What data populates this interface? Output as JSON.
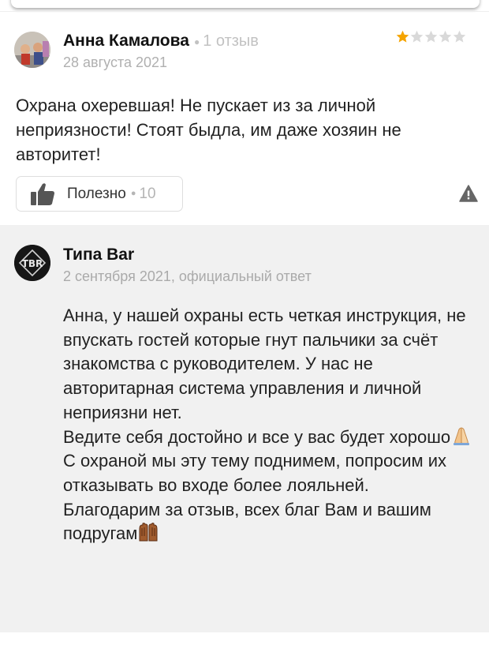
{
  "review": {
    "author_name": "Анна Камалова",
    "author_reviews": "1 отзыв",
    "date": "28 августа 2021",
    "rating": 1,
    "rating_max": 5,
    "colors": {
      "star_filled": "#f5a400",
      "star_empty": "#d9d9d9"
    },
    "text": "Охрана охеревшая! Не пускает из за личной неприязности! Стоят быдла, им даже хозяин не авторитет!",
    "useful_label": "Полезно",
    "useful_count": "10",
    "icons": {
      "like": "thumbs-up-icon",
      "report": "warning-icon"
    }
  },
  "answer": {
    "org_name": "Типа Bar",
    "date_line": "2 сентября 2021, официальный ответ",
    "paragraphs": [
      "Анна, у нашей охраны есть четкая инструкция, не впускать гостей которые гнут пальчики за счёт знакомства с руководителем. У нас не авторитарная система управления и личной неприязни нет.",
      "Ведите себя достойно и все у вас будет хорошо",
      "С охраной мы эту тему поднимем, попросим их отказывать во входе более лояльней.",
      "Благодарим за отзыв, всех благ Вам и вашим подругам"
    ],
    "emojis": [
      "folded-hands-emoji",
      "raised-hands-emoji"
    ],
    "background": "#f1f1f1"
  }
}
